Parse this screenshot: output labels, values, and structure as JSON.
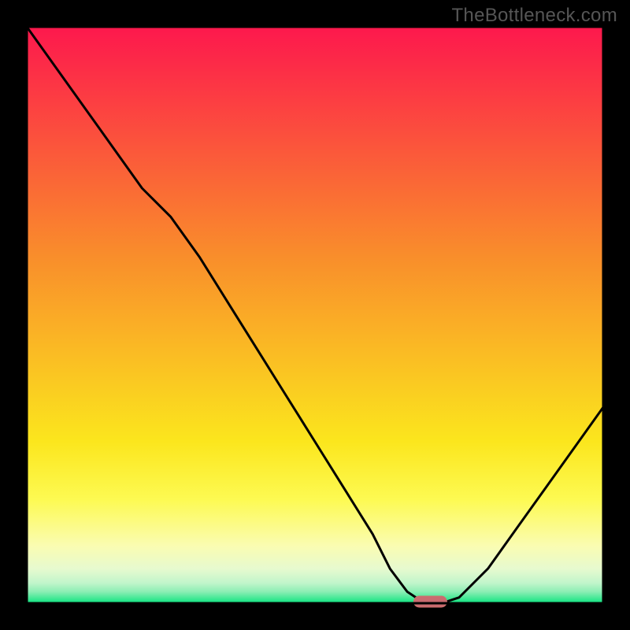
{
  "watermark": "TheBottleneck.com",
  "colors": {
    "frame": "#000000",
    "curve": "#000000",
    "marker_fill": "#c96b6f",
    "marker_stroke": "#cf6f6c",
    "gradient_top": "#fd184d",
    "gradient_mid1": "#f98e2b",
    "gradient_mid2": "#fbe61d",
    "gradient_low1": "#fdfa52",
    "gradient_low2": "#fafcb1",
    "gradient_low3": "#e7facf",
    "gradient_low4": "#c1f5cb",
    "gradient_low5": "#8ceeb4",
    "gradient_bottom": "#0de47f"
  },
  "chart_data": {
    "type": "line",
    "title": "",
    "xlabel": "",
    "ylabel": "",
    "xlim": [
      0,
      100
    ],
    "ylim": [
      0,
      100
    ],
    "optimum_x": 70,
    "series": [
      {
        "name": "bottleneck-curve",
        "x": [
          0,
          5,
          10,
          15,
          20,
          25,
          30,
          35,
          40,
          45,
          50,
          55,
          60,
          63,
          66,
          69,
          72,
          75,
          80,
          85,
          90,
          95,
          100
        ],
        "values": [
          100,
          93,
          86,
          79,
          72,
          67,
          60,
          52,
          44,
          36,
          28,
          20,
          12,
          6,
          2,
          0,
          0,
          1,
          6,
          13,
          20,
          27,
          34
        ]
      }
    ],
    "marker": {
      "x": 70,
      "y": 0
    }
  }
}
